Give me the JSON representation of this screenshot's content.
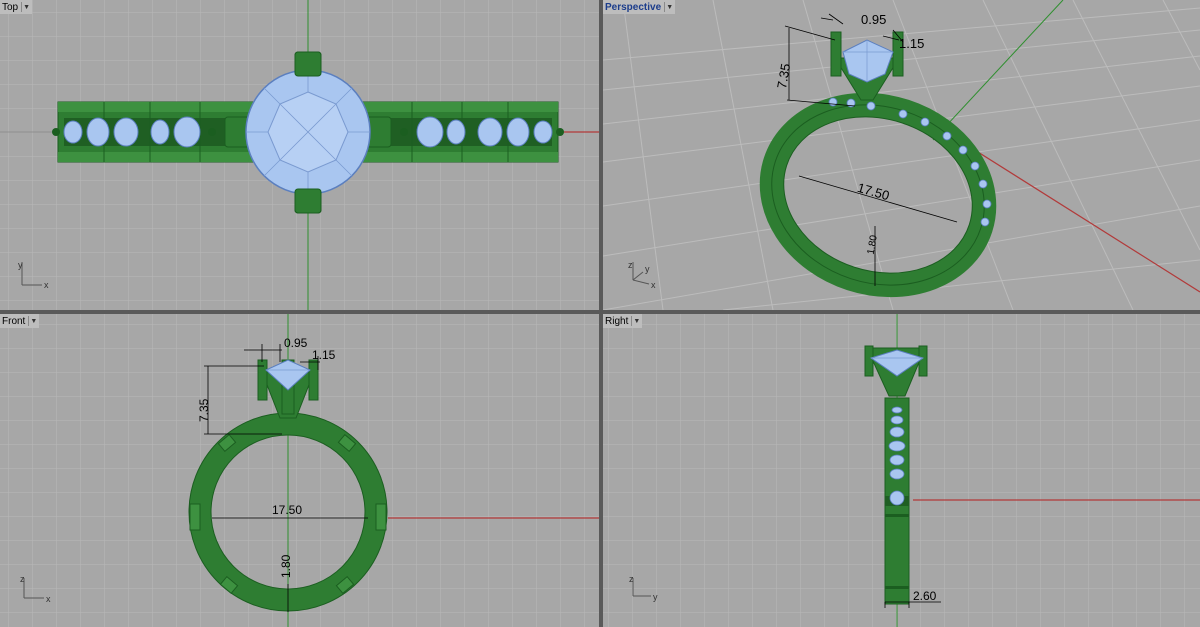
{
  "colors": {
    "viewport_bg": "#a7a7a7",
    "grid": "#b9b9b9",
    "grid_major": "#8f8f8f",
    "ring_green": "#2e7d32",
    "ring_green_light": "#4caf50",
    "gem_blue": "#a9c6f0",
    "x_axis": "#b23a3a",
    "y_axis": "#2f8f2f",
    "frame": "#ffffff"
  },
  "viewports": {
    "top": {
      "title": "Top",
      "axis_a": "y",
      "axis_b": "x"
    },
    "perspective": {
      "title": "Perspective",
      "axis_a": "z",
      "axis_b": "x",
      "axis_c": "y",
      "dims": {
        "prong_gap": "0.95",
        "prong_width": "1.15",
        "head_height": "7.35",
        "inner_diameter": "17.50",
        "band_thickness": "1.80"
      }
    },
    "front": {
      "title": "Front",
      "axis_a": "z",
      "axis_b": "x",
      "dims": {
        "prong_gap": "0.95",
        "prong_width": "1.15",
        "head_height": "7.35",
        "inner_diameter": "17.50",
        "band_thickness": "1.80"
      }
    },
    "right": {
      "title": "Right",
      "axis_a": "z",
      "axis_b": "y",
      "dims": {
        "band_width": "2.60"
      }
    }
  }
}
